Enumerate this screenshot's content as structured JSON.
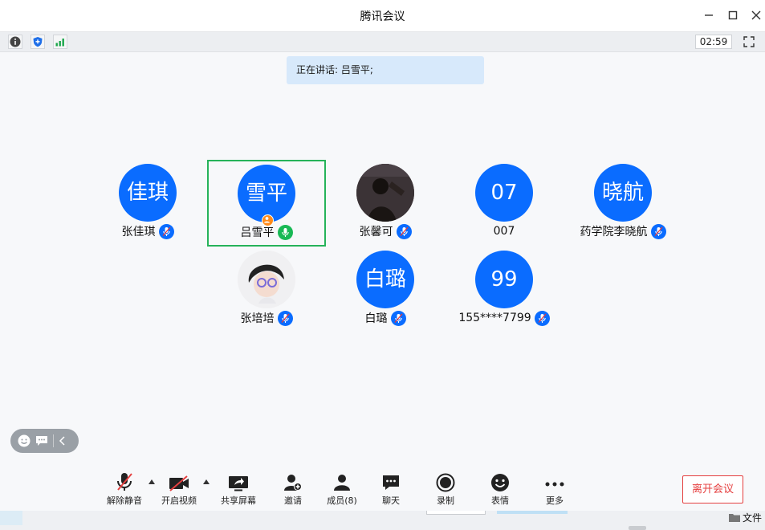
{
  "window": {
    "title": "腾讯会议"
  },
  "statusbar": {
    "timer": "02:59"
  },
  "speaking": {
    "text": "正在讲话: 吕雪平;"
  },
  "colors": {
    "accent": "#0a6cff",
    "active_border": "#26b35a",
    "mic_active": "#19b955",
    "leave": "#e53f3f"
  },
  "participants": [
    {
      "avatar_text": "佳琪",
      "name": "张佳琪",
      "mic": "muted"
    },
    {
      "avatar_text": "雪平",
      "name": "吕雪平",
      "mic": "speaking",
      "host": true,
      "active": true
    },
    {
      "avatar_text": "",
      "name": "张馨可",
      "mic": "muted",
      "avatar": "photo"
    },
    {
      "avatar_text": "07",
      "name": "007",
      "mic": "muted"
    },
    {
      "avatar_text": "晓航",
      "name": "药学院李晓航",
      "mic": "muted"
    },
    {
      "avatar_text": "",
      "name": "张培培",
      "mic": "muted",
      "avatar": "photo"
    },
    {
      "avatar_text": "白璐",
      "name": "白璐",
      "mic": "muted"
    },
    {
      "avatar_text": "99",
      "name": "155****7799",
      "mic": "muted"
    }
  ],
  "toolbar": {
    "unmute": "解除静音",
    "video": "开启视频",
    "share": "共享屏幕",
    "invite": "邀请",
    "members": "成员(8)",
    "chat": "聊天",
    "record": "录制",
    "emoji": "表情",
    "more": "更多",
    "leave": "离开会议"
  },
  "taskbar": {
    "file_label": "文件"
  }
}
